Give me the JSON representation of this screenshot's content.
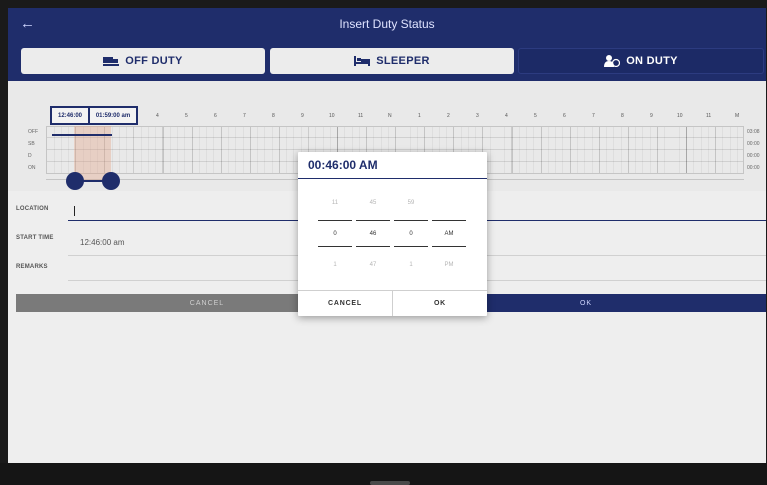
{
  "app": {
    "title": "Insert Duty Status",
    "back_icon": "arrow-left-icon"
  },
  "status_buttons": [
    {
      "label": "OFF DUTY",
      "icon": "truck-icon",
      "selected": false
    },
    {
      "label": "SLEEPER",
      "icon": "bed-icon",
      "selected": false
    },
    {
      "label": "ON DUTY",
      "icon": "person-clock-icon",
      "selected": true
    }
  ],
  "grid": {
    "hours": [
      "4",
      "5",
      "6",
      "7",
      "8",
      "9",
      "10",
      "11",
      "N",
      "1",
      "2",
      "3",
      "4",
      "5",
      "6",
      "7",
      "8",
      "9",
      "10",
      "11",
      "M"
    ],
    "rows": [
      "OFF",
      "SB",
      "D",
      "ON"
    ],
    "totals": [
      "03:08",
      "00:00",
      "00:00",
      "00:00"
    ],
    "start_tag": "12:46:00",
    "end_tag": "01:59:00 am"
  },
  "form": {
    "location_label": "LOCATION",
    "location_value": "",
    "start_time_label": "START TIME",
    "start_time_value": "12:46:00 am",
    "remarks_label": "REMARKS",
    "remarks_value": ""
  },
  "actions": {
    "cancel": "CANCEL",
    "ok": "OK"
  },
  "dialog": {
    "title": "00:46:00 AM",
    "columns": [
      {
        "name": "hour",
        "prev": "11",
        "current": "0",
        "next": "1"
      },
      {
        "name": "minute",
        "prev": "45",
        "current": "46",
        "next": "47"
      },
      {
        "name": "second",
        "prev": "59",
        "current": "0",
        "next": "1"
      },
      {
        "name": "ampm",
        "prev": "",
        "current": "AM",
        "next": "PM"
      }
    ],
    "cancel": "CANCEL",
    "ok": "OK"
  },
  "colors": {
    "primary": "#1f2d6b",
    "background": "#eeeeee"
  }
}
